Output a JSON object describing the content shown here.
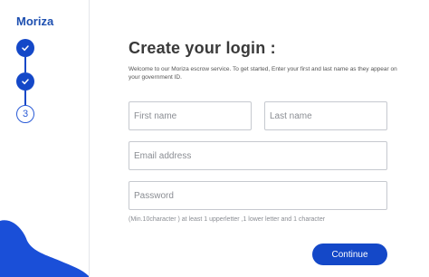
{
  "app": {
    "logo": "Moriza"
  },
  "steps": [
    {
      "status": "completed",
      "icon": "check-icon"
    },
    {
      "status": "completed",
      "icon": "check-icon"
    },
    {
      "status": "pending",
      "label": "3"
    }
  ],
  "form": {
    "title": "Create your login  :",
    "intro": "Welcome to our Moriza escrow service. To get started, Enter your first and last name as they appear on your government ID.",
    "first_name": {
      "placeholder": "First name",
      "value": ""
    },
    "last_name": {
      "placeholder": "Last name",
      "value": ""
    },
    "email": {
      "placeholder": "Email address",
      "value": ""
    },
    "password": {
      "placeholder": "Password",
      "value": ""
    },
    "password_hint": "(Min.10character ) at least 1 upperletter ,1 lower letter and 1 character",
    "continue_label": "Continue"
  },
  "colors": {
    "primary": "#1448c8",
    "border": "#c6c9cf",
    "text": "#3a3a3a"
  }
}
